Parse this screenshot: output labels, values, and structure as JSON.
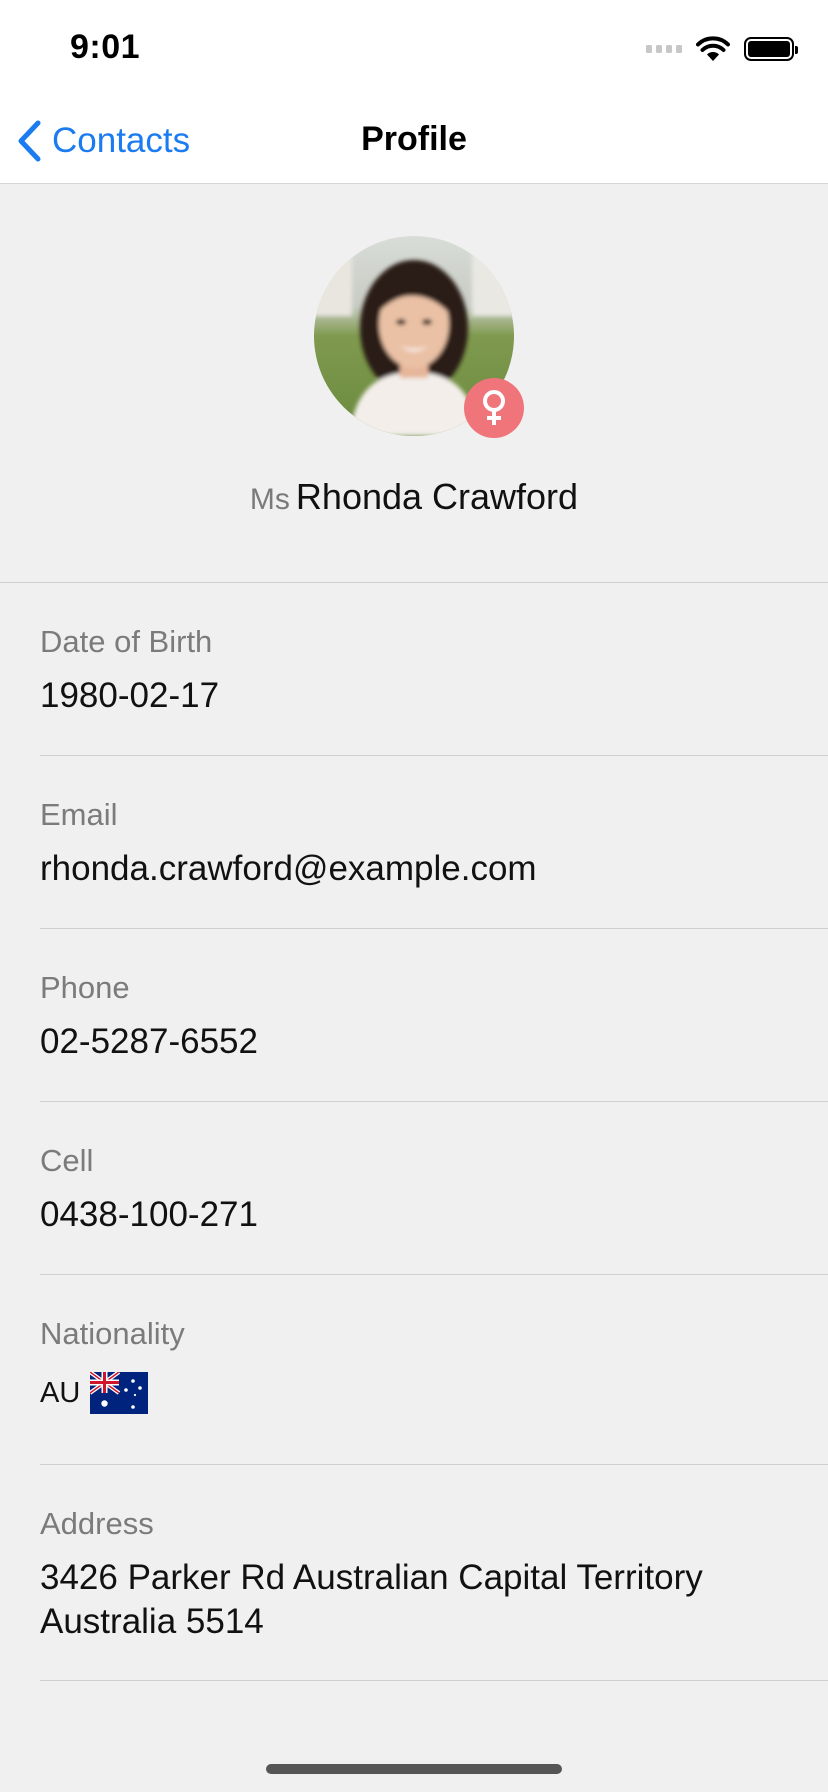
{
  "status_bar": {
    "time": "9:01"
  },
  "nav": {
    "back_label": "Contacts",
    "title": "Profile"
  },
  "profile": {
    "title": "Ms",
    "name": "Rhonda Crawford",
    "gender_icon": "female-symbol-icon",
    "badge_color": "#f0757b"
  },
  "fields": {
    "dob": {
      "label": "Date of Birth",
      "value": "1980-02-17"
    },
    "email": {
      "label": "Email",
      "value": "rhonda.crawford@example.com"
    },
    "phone": {
      "label": "Phone",
      "value": "02-5287-6552"
    },
    "cell": {
      "label": "Cell",
      "value": "0438-100-271"
    },
    "nationality": {
      "label": "Nationality",
      "code": "AU",
      "flag_icon": "australia-flag-icon"
    },
    "address": {
      "label": "Address",
      "value": "3426 Parker Rd Australian Capital Territory Australia 5514"
    }
  },
  "colors": {
    "accent": "#1a7cf0",
    "background": "#f0f0f0"
  }
}
